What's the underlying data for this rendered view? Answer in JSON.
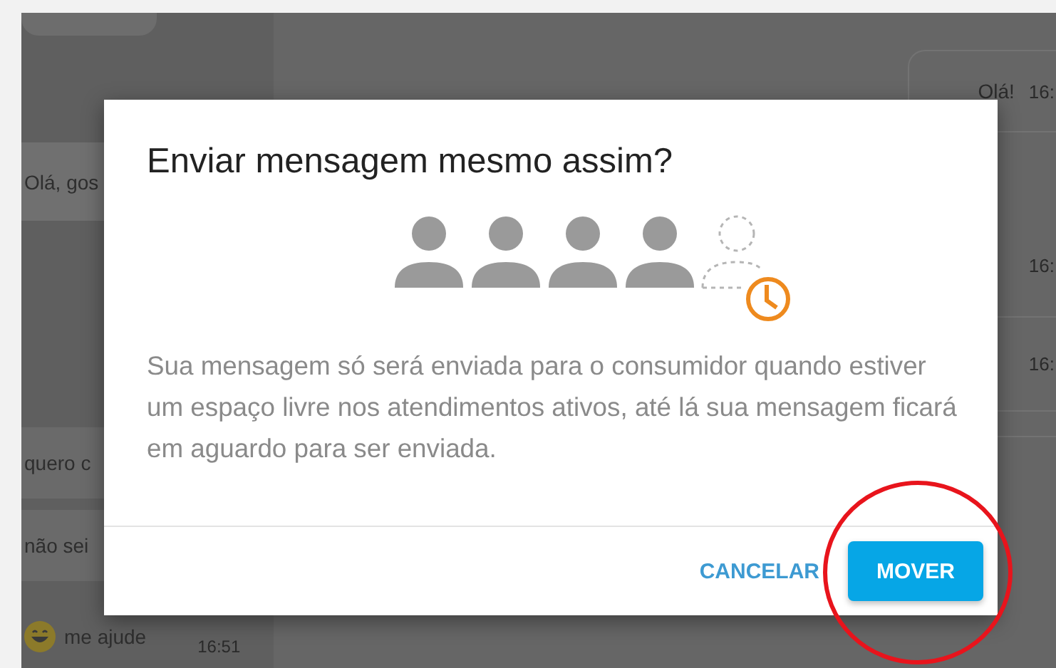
{
  "chat": {
    "left_messages": [
      {
        "text": "Olá, gos",
        "emoji": false
      },
      {
        "text": "quero c",
        "emoji": false
      },
      {
        "text": "não sei",
        "emoji": false
      },
      {
        "text": "me ajude",
        "time": "16:51",
        "emoji": true
      }
    ],
    "right_messages": [
      {
        "text": "Olá!",
        "time": "16:"
      },
      {
        "time": "16:"
      },
      {
        "time": "16:"
      }
    ]
  },
  "dialog": {
    "title": "Enviar mensagem mesmo assim?",
    "body": "Sua mensagem só será enviada para o consumidor quando estiver um espaço livre nos atendimentos ativos, até lá sua mensagem ficará em aguardo para ser enviada.",
    "buttons": [
      {
        "label": "CANCELAR",
        "kind": "text"
      },
      {
        "label": "MOVER",
        "kind": "primary"
      }
    ]
  }
}
